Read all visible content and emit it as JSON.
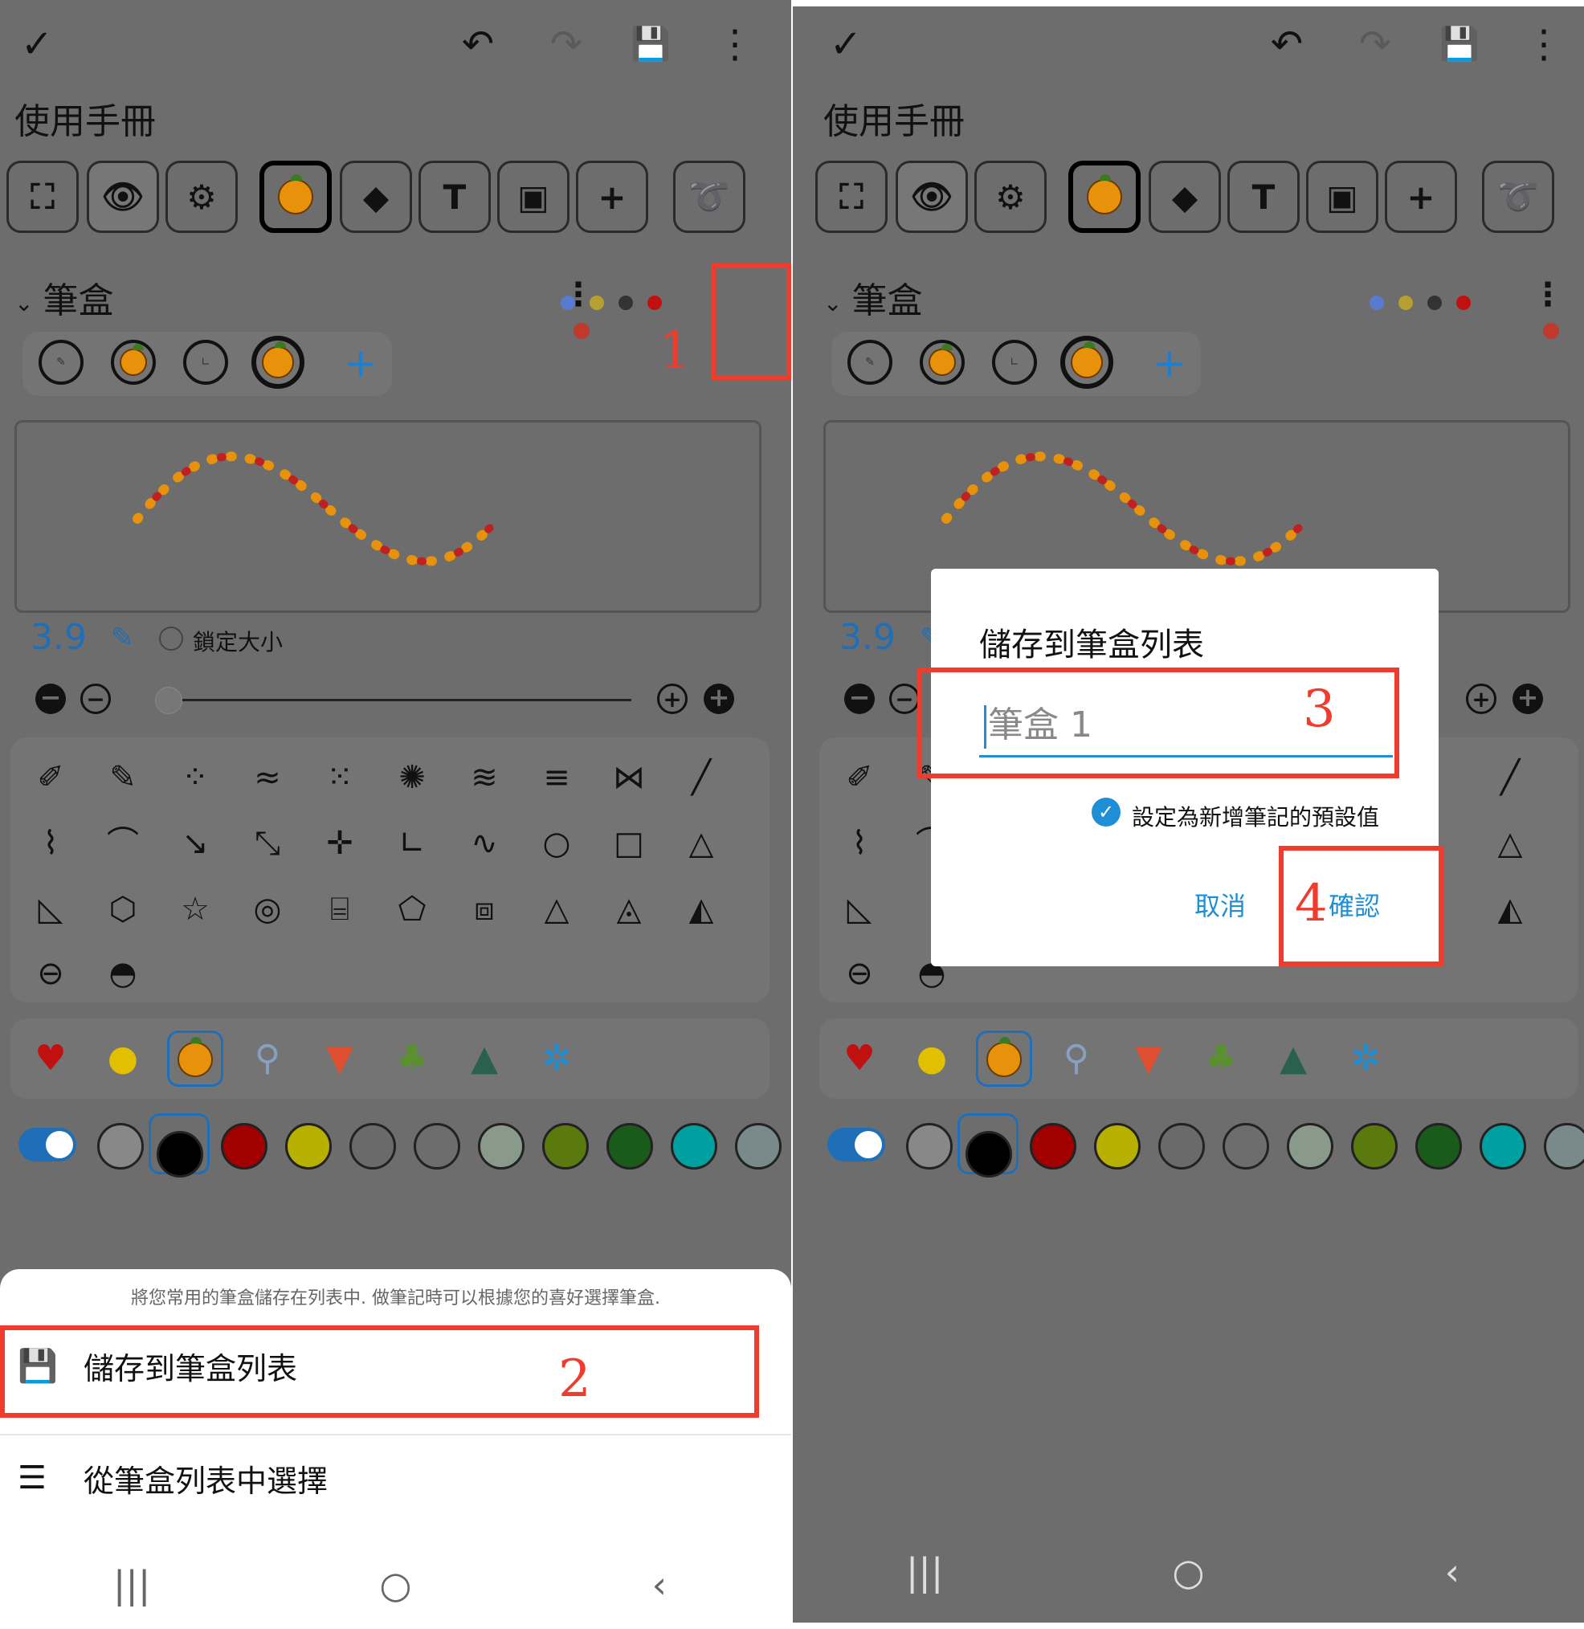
{
  "screen1": {
    "title": "使用手冊",
    "pen_header": "筆盒",
    "size_value": "3.9",
    "lock_label": "鎖定大小",
    "sheet_hint": "將您常用的筆盒儲存在列表中. 做筆記時可以根據您的喜好選擇筆盒.",
    "sheet_items": [
      "儲存到筆盒列表",
      "從筆盒列表中選擇"
    ],
    "markers": [
      "1",
      "2"
    ]
  },
  "screen2": {
    "title": "使用手冊",
    "pen_header": "筆盒",
    "size_value": "3.9",
    "dialog": {
      "title": "儲存到筆盒列表",
      "input_value": "筆盒 1",
      "checkbox_label": "設定為新增筆記的預設值",
      "cancel": "取消",
      "confirm": "確認"
    },
    "markers": [
      "3",
      "4"
    ]
  },
  "toolbar": {
    "check": "✓",
    "undo": "↶",
    "redo": "↷",
    "save": "💾",
    "more": "⋮",
    "text_tool": "T",
    "add_tool": "+"
  },
  "icons": {
    "nav": [
      "|||",
      "○",
      "‹"
    ],
    "size_controls": [
      "−",
      "−",
      "+",
      "+"
    ]
  },
  "colors": {
    "accent": "#1e6fb8",
    "highlight": "#f03c2f",
    "swatches": [
      "#000000",
      "#a00000",
      "#b8b000",
      "#6a6a6a",
      "#6d6d6d",
      "#8a9a8a",
      "#5a7a10",
      "#1a5a1a",
      "#00a0a0",
      "#7a8a8a"
    ]
  }
}
